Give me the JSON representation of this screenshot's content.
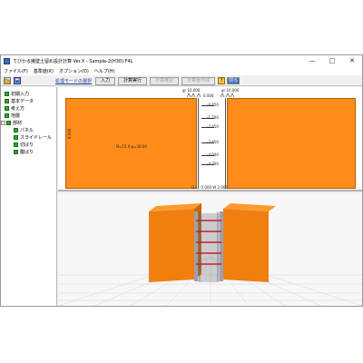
{
  "window": {
    "title": "てびかる擁壁土留め設計計算 Ver.X - Sample-2(H30).F4L",
    "minimize": "—",
    "maximize": "□",
    "close": "✕"
  },
  "menu": [
    "ファイル(F)",
    "基準値(K)",
    "オプション(O)",
    "ヘルプ(H)"
  ],
  "toolbar": {
    "mode_label": "処理モードの選択",
    "input_label": "入力",
    "calc_label": "計算実行",
    "calc_confirm_label": "計算確認",
    "report_label": "計算書作成",
    "close_label": "閉る",
    "help_glyph": "?"
  },
  "tree": {
    "items": [
      {
        "label": "初期入力",
        "indent": 0
      },
      {
        "label": "基本データ",
        "indent": 0
      },
      {
        "label": "考え方",
        "indent": 0
      },
      {
        "label": "地層",
        "indent": 0
      },
      {
        "label": "部材",
        "indent": 0,
        "expander": "-"
      },
      {
        "label": "パネル",
        "indent": 1
      },
      {
        "label": "スライドレール",
        "indent": 1
      },
      {
        "label": "切ばり",
        "indent": 1
      },
      {
        "label": "腹ばり",
        "indent": 1
      }
    ]
  },
  "plan": {
    "top_left_marker": "gr 10.000",
    "top_right_marker": "gr 10.000",
    "top_value": "0.000",
    "left_vertical": "8.000",
    "soil_note": "N=15.0  φ=30.00",
    "levels": [
      "-0.450",
      "-1.700",
      "-2.450",
      "-3.450",
      "-4.000",
      "-4.700"
    ],
    "bottom_note": "G.L. -5.000  W 2.000",
    "soil_color": "#ff8c1a"
  },
  "view3d": {
    "block_color": "#ff8c1a",
    "strut_color": "#c0202a"
  }
}
